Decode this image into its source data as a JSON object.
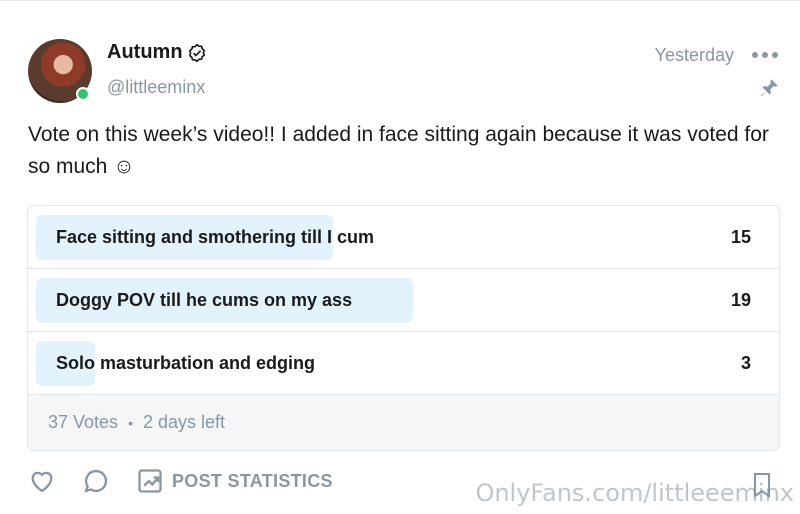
{
  "author": {
    "name": "Autumn",
    "handle": "@littleeminx",
    "time": "Yesterday",
    "online": true
  },
  "post": {
    "text": "Vote on this week’s video!! I added in face sitting again because it was voted for so much ☺"
  },
  "poll": {
    "options": [
      {
        "label": "Face sitting and smothering till I cum",
        "count": "15",
        "share": 0.405
      },
      {
        "label": "Doggy POV till he cums on my ass",
        "count": "19",
        "share": 0.514
      },
      {
        "label": "Solo masturbation and edging",
        "count": "3",
        "share": 0.081
      }
    ],
    "votes": "37 Votes",
    "separator": "•",
    "time_left": "2 days left"
  },
  "actions": {
    "stats_label": "POST STATISTICS"
  },
  "watermark": "OnlyFans.com/littleeeminx",
  "colors": {
    "bar": "#e3f3fd",
    "online": "#38c172",
    "muted": "#8a96a3"
  }
}
